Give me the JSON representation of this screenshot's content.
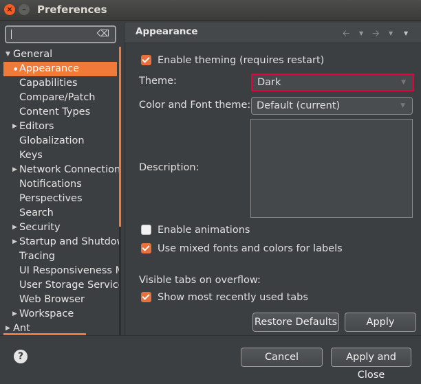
{
  "window": {
    "title": "Preferences",
    "close_glyph": "×",
    "minimize_glyph": "–"
  },
  "search": {
    "value": "",
    "clear_icon": "clear-icon"
  },
  "tree": {
    "items": [
      {
        "label": "General",
        "expanded": true
      },
      {
        "label": "Appearance",
        "selected": true
      },
      {
        "label": "Capabilities"
      },
      {
        "label": "Compare/Patch"
      },
      {
        "label": "Content Types"
      },
      {
        "label": "Editors",
        "has_children": true
      },
      {
        "label": "Globalization"
      },
      {
        "label": "Keys"
      },
      {
        "label": "Network Connections",
        "has_children": true
      },
      {
        "label": "Notifications"
      },
      {
        "label": "Perspectives"
      },
      {
        "label": "Search"
      },
      {
        "label": "Security",
        "has_children": true
      },
      {
        "label": "Startup and Shutdown",
        "has_children": true
      },
      {
        "label": "Tracing"
      },
      {
        "label": "UI Responsiveness Monitoring"
      },
      {
        "label": "User Storage Service"
      },
      {
        "label": "Web Browser"
      },
      {
        "label": "Workspace",
        "has_children": true
      },
      {
        "label": "Ant",
        "has_children": true
      }
    ]
  },
  "page": {
    "title": "Appearance",
    "nav_icons": [
      "back-arrow-icon",
      "back-menu-icon",
      "forward-arrow-icon",
      "forward-menu-icon",
      "view-menu-icon"
    ]
  },
  "settings": {
    "enable_theming": {
      "label": "Enable theming (requires restart)",
      "checked": true
    },
    "theme": {
      "label": "Theme:",
      "value": "Dark"
    },
    "color_font_theme": {
      "label": "Color and Font theme:",
      "value": "Default (current)"
    },
    "description": {
      "label": "Description:",
      "value": ""
    },
    "enable_animations": {
      "label": "Enable animations",
      "checked": false
    },
    "mixed_fonts": {
      "label": "Use mixed fonts and colors for labels",
      "checked": true
    },
    "visible_tabs": {
      "label": "Visible tabs on overflow:"
    },
    "show_recent_tabs": {
      "label": "Show most recently used tabs",
      "checked": true
    }
  },
  "buttons": {
    "restore_defaults": "Restore Defaults",
    "apply": "Apply",
    "cancel": "Cancel",
    "apply_and_close": "Apply and Close",
    "help": "?"
  },
  "colors": {
    "accent": "#f07a3a",
    "background": "#3c3f41",
    "theme_highlight": "#e4003a"
  }
}
